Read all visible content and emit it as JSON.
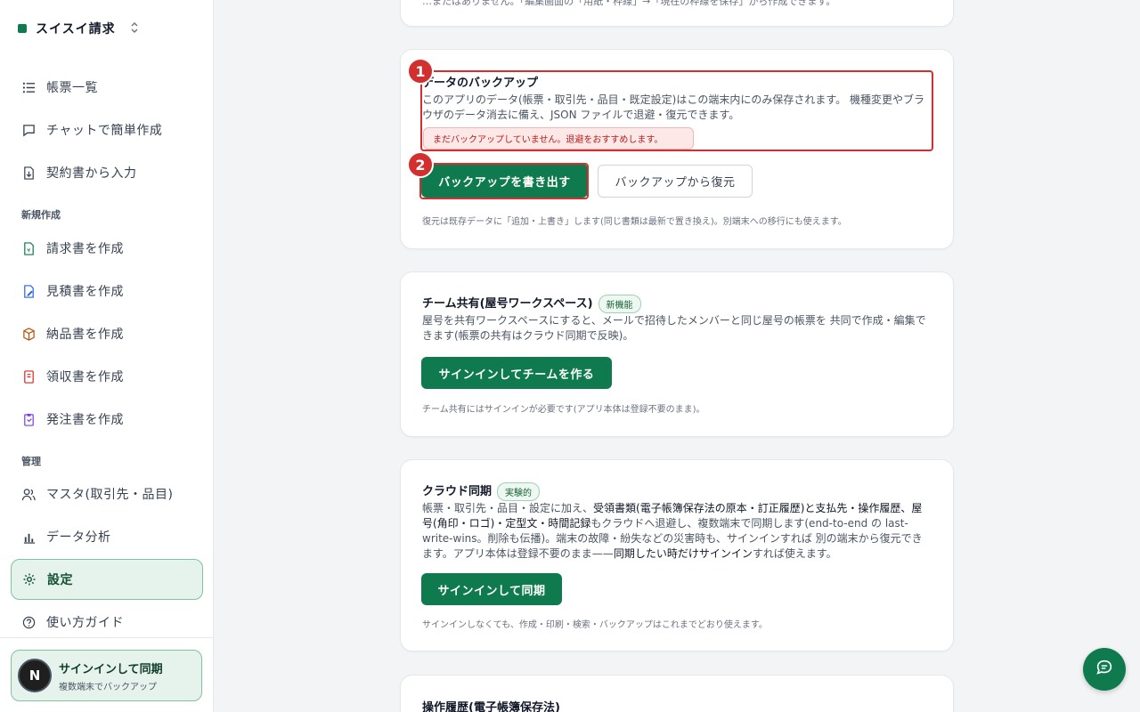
{
  "brand": {
    "name": "スイスイ請求",
    "chevron": "⌃⌄"
  },
  "sidebar": {
    "items": [
      {
        "label": "帳票一覧",
        "icon": "list-icon"
      },
      {
        "label": "チャットで簡単作成",
        "icon": "chat-icon"
      },
      {
        "label": "契約書から入力",
        "icon": "file-import-icon"
      }
    ],
    "section_new": "新規作成",
    "new_items": [
      {
        "label": "請求書を作成",
        "icon": "invoice-icon"
      },
      {
        "label": "見積書を作成",
        "icon": "estimate-icon"
      },
      {
        "label": "納品書を作成",
        "icon": "box-icon"
      },
      {
        "label": "領収書を作成",
        "icon": "receipt-icon"
      },
      {
        "label": "発注書を作成",
        "icon": "clipboard-icon"
      }
    ],
    "section_admin": "管理",
    "admin_items": [
      {
        "label": "マスタ(取引先・品目)",
        "icon": "users-icon"
      },
      {
        "label": "データ分析",
        "icon": "bar-chart-icon"
      },
      {
        "label": "設定",
        "icon": "gear-icon",
        "active": true
      },
      {
        "label": "使い方ガイド",
        "icon": "help-icon"
      }
    ],
    "signin": {
      "avatar": "N",
      "title": "サインインして同期",
      "subtitle": "複数端末でバックアップ"
    }
  },
  "top_card": {
    "partial_text": "…またはありません。「編集画面の「用紙・枠線」→「現在の枠線を保存」から作成できます。"
  },
  "backup": {
    "title": "データのバックアップ",
    "body": "このアプリのデータ(帳票・取引先・品目・既定設定)はこの端末内にのみ保存されます。 機種変更やブラウザのデータ消去に備え、JSON ファイルで退避・復元できます。",
    "warning": "まだバックアップしていません。退避をおすすめします。",
    "export_button": "バックアップを書き出す",
    "restore_button": "バックアップから復元",
    "note": "復元は既存データに「追加・上書き」します(同じ書類は最新で置き換え)。別端末への移行にも使えます。",
    "marker1": "1",
    "marker2": "2"
  },
  "team": {
    "title": "チーム共有(屋号ワークスペース)",
    "badge": "新機能",
    "body": "屋号を共有ワークスペースにすると、メールで招待したメンバーと同じ屋号の帳票を 共同で作成・編集できます(帳票の共有はクラウド同期で反映)。",
    "button": "サインインしてチームを作る",
    "note": "チーム共有にはサインインが必要です(アプリ本体は登録不要のまま)。"
  },
  "cloud": {
    "title": "クラウド同期",
    "badge": "実験的",
    "body_pre": "帳票・取引先・品目・設定に加え、",
    "body_bold1": "受領書類(電子帳簿保存法の原本・訂正履歴)と支払先・操作履歴、屋号(角印・ロゴ)・定型文・時間記録",
    "body_mid": "もクラウドへ退避し、複数端末で同期します(end-to-end の last-write-wins。削除も伝播)。端末の故障・紛失などの災害時も、サインインすれば 別の端末から復元できます。アプリ本体は登録不要のまま——",
    "body_bold2": "同期したい時だけサインイン",
    "body_post": "すれば使えます。",
    "button": "サインインして同期",
    "note": "サインインしなくても、作成・印刷・検索・バックアップはこれまでどおり使えます。"
  },
  "history": {
    "title": "操作履歴(電子帳簿保存法)"
  },
  "colors": {
    "accent": "#0f7a4d",
    "highlight": "#d32f2f"
  }
}
